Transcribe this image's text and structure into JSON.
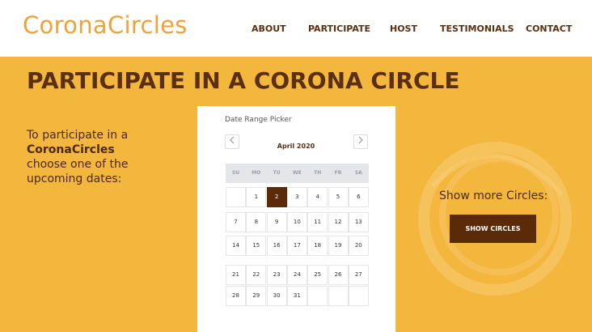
{
  "header": {
    "logo": "CoronaCircles",
    "nav": [
      "ABOUT",
      "PARTICIPATE",
      "HOST",
      "TESTIMONIALS",
      "CONTACT"
    ]
  },
  "hero": {
    "title": "PARTICIPATE IN A CORONA CIRCLE"
  },
  "intro": {
    "line1": "To participate in a",
    "brand": "CoronaCircles",
    "line3": "choose one of the",
    "line4": "upcoming dates:"
  },
  "picker": {
    "label": "Date Range Picker",
    "month": "April 2020",
    "prev_icon": "chevron-left-icon",
    "next_icon": "chevron-right-icon",
    "weekdays": [
      "SU",
      "MO",
      "TU",
      "WE",
      "TH",
      "FR",
      "SA"
    ],
    "weeks": [
      [
        "",
        "1",
        "2",
        "3",
        "4",
        "5",
        "6"
      ],
      [
        "7",
        "8",
        "9",
        "10",
        "11",
        "12",
        "13"
      ],
      [
        "14",
        "15",
        "16",
        "17",
        "18",
        "19",
        "20"
      ],
      [
        "21",
        "22",
        "23",
        "24",
        "25",
        "26",
        "27"
      ],
      [
        "28",
        "29",
        "30",
        "31",
        "",
        "",
        ""
      ]
    ],
    "selected": "2"
  },
  "sidebar": {
    "heading": "Show more Circles:",
    "button": "SHOW CIRCLES"
  },
  "colors": {
    "background": "#f4b73e",
    "brand_brown": "#5a2a09",
    "logo_orange": "#f0a23a"
  }
}
